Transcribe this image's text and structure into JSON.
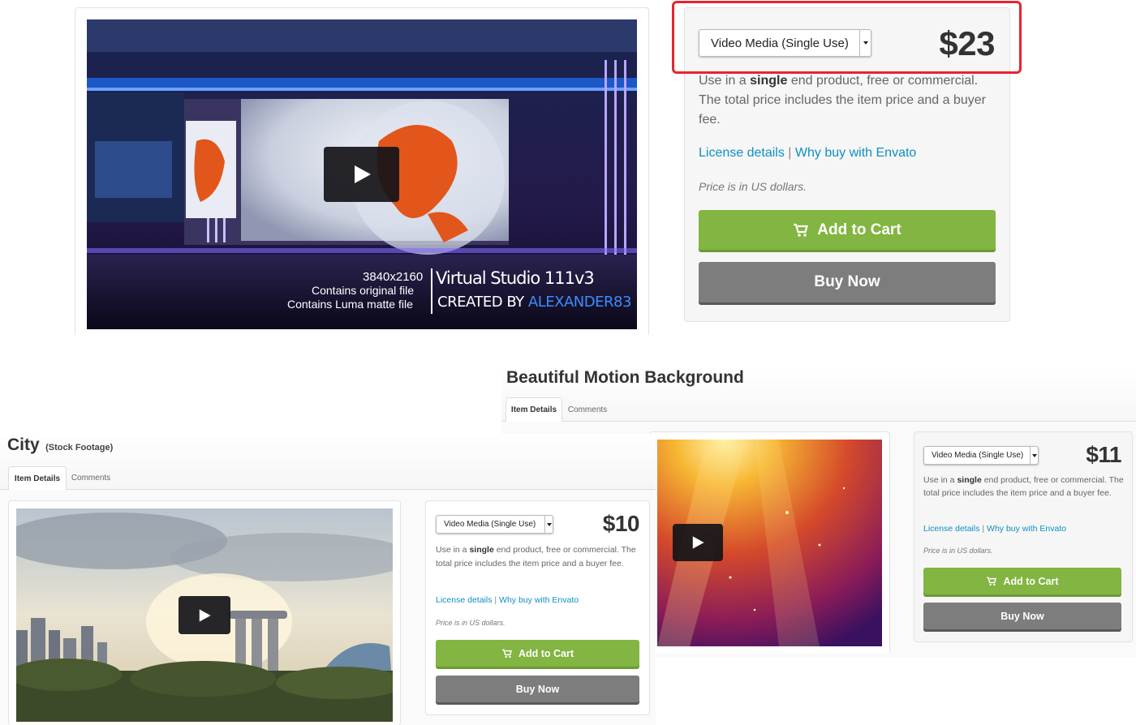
{
  "panel_top": {
    "video": {
      "overlay_res": "3840x2160",
      "overlay_line1": "Contains original file",
      "overlay_line2": "Contains Luma matte file",
      "overlay_title": "Virtual Studio 111v3",
      "overlay_credit_prefix": "CREATED BY",
      "overlay_credit_name": "ALEXANDER83"
    },
    "license_select": "Video Media (Single Use)",
    "price": "$23",
    "desc_pre": "Use in a ",
    "desc_bold": "single",
    "desc_post": " end product, free or commercial. The total price includes the item price and a buyer fee.",
    "link_license": "License details",
    "link_sep": "|",
    "link_why": "Why buy with Envato",
    "note": "Price is in US dollars.",
    "add_to_cart": "Add to Cart",
    "buy_now": "Buy Now"
  },
  "panel_motion": {
    "title": "Beautiful Motion Background",
    "tab_details": "Item Details",
    "tab_comments": "Comments",
    "license_select": "Video Media (Single Use)",
    "price": "$11",
    "desc_pre": "Use in a ",
    "desc_bold": "single",
    "desc_post": " end product, free or commercial. The total price includes the item price and a buyer fee.",
    "link_license": "License details",
    "link_sep": "|",
    "link_why": "Why buy with Envato",
    "note": "Price is in US dollars.",
    "add_to_cart": "Add to Cart",
    "buy_now": "Buy Now"
  },
  "panel_city": {
    "title": "City",
    "subtitle": "(Stock Footage)",
    "tab_details": "Item Details",
    "tab_comments": "Comments",
    "license_select": "Video Media (Single Use)",
    "price": "$10",
    "desc_pre": "Use in a ",
    "desc_bold": "single",
    "desc_post": " end product, free or commercial. The total price includes the item price and a buyer fee.",
    "link_license": "License details",
    "link_sep": "|",
    "link_why": "Why buy with Envato",
    "note": "Price is in US dollars.",
    "add_to_cart": "Add to Cart",
    "buy_now": "Buy Now"
  },
  "icons": {
    "play": "play-icon",
    "cart": "cart-icon",
    "caret": "chevron-down-icon"
  },
  "colors": {
    "accent_green": "#82b541",
    "gray_button": "#7d7d7d",
    "link_blue": "#0f8fc4",
    "highlight_red": "#e8242d"
  }
}
